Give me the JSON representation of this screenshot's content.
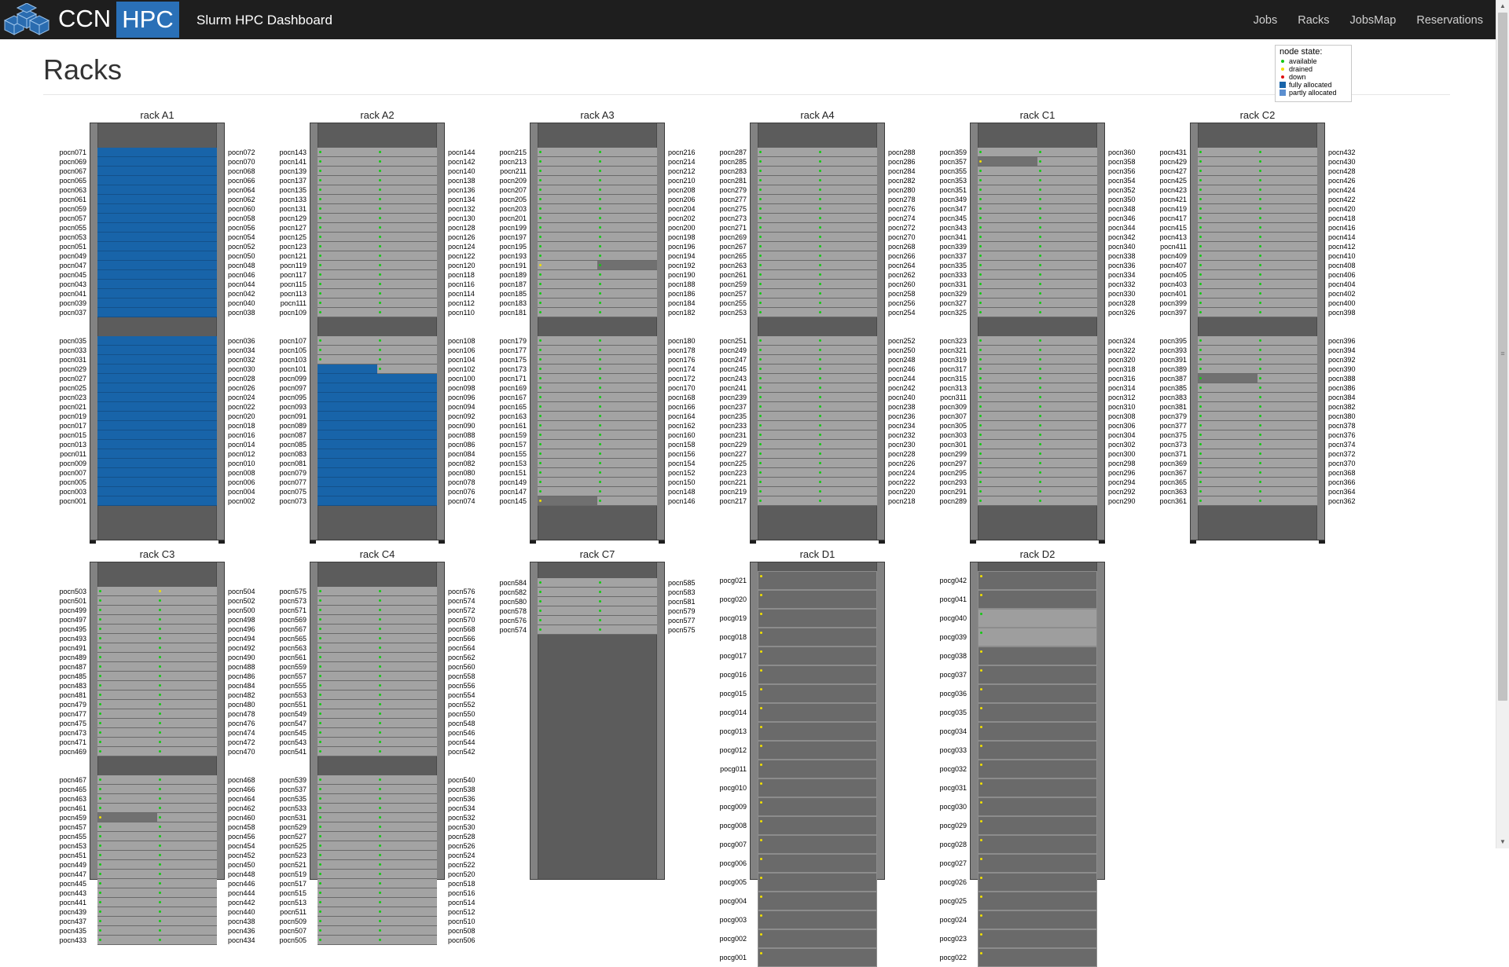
{
  "nav": {
    "brand_ccn": "CCN",
    "brand_hpc": "HPC",
    "title": "Slurm HPC Dashboard",
    "links": [
      "Jobs",
      "Racks",
      "JobsMap",
      "Reservations"
    ]
  },
  "page": {
    "title": "Racks"
  },
  "legend": {
    "title": "node state:",
    "items": [
      {
        "label": "available",
        "color": "#14c814"
      },
      {
        "label": "drained",
        "color": "#f0e000"
      },
      {
        "label": "down",
        "color": "#e01010"
      },
      {
        "label": "fully allocated",
        "color": "#1864a9"
      },
      {
        "label": "partly allocated",
        "color": "#5b8fd0"
      }
    ]
  },
  "colors": {
    "fully_allocated": "#1864a9",
    "available": "#14c814",
    "drained": "#f0e000",
    "navbar": "#1e1e1e",
    "hpc_badge": "#2a70b7"
  },
  "racks": [
    {
      "name": "rack A1",
      "start": 1,
      "full": [
        1,
        2,
        3,
        4,
        5,
        6,
        7,
        8,
        9,
        10,
        11,
        12,
        13,
        14,
        15,
        16,
        17,
        18,
        19,
        20,
        21,
        22,
        23,
        24,
        25,
        26,
        27,
        28,
        29,
        30,
        31,
        32,
        33,
        34,
        35,
        36,
        37,
        38,
        39,
        40,
        41,
        42,
        43,
        44,
        45,
        46,
        47,
        48,
        49,
        50,
        51,
        52,
        53,
        54,
        55,
        56,
        57,
        58,
        59,
        60,
        61,
        62,
        63,
        64,
        65,
        66,
        67,
        68,
        69,
        70,
        71,
        72
      ],
      "drained": [],
      "drained_bg": []
    },
    {
      "name": "rack A2",
      "start": 73,
      "full": [
        73,
        74,
        75,
        76,
        77,
        78,
        79,
        80,
        81,
        82,
        83,
        84,
        85,
        86,
        87,
        88,
        89,
        90,
        91,
        92,
        93,
        94,
        95,
        96,
        97,
        98,
        99,
        100,
        101
      ],
      "drained": [],
      "drained_bg": []
    },
    {
      "name": "rack A3",
      "start": 145,
      "full": [],
      "drained": [
        145,
        191
      ],
      "drained_bg": [
        145,
        192
      ]
    },
    {
      "name": "rack A4",
      "start": 217,
      "full": [],
      "drained": [],
      "drained_bg": []
    },
    {
      "name": "rack C1",
      "start": 289,
      "full": [],
      "drained": [
        357
      ],
      "drained_bg": [
        357
      ]
    },
    {
      "name": "rack C2",
      "start": 361,
      "full": [],
      "drained": [],
      "drained_bg": [
        387
      ]
    },
    {
      "name": "rack C3",
      "start": 433,
      "full": [],
      "drained": [
        459,
        504
      ],
      "drained_bg": [
        459
      ]
    },
    {
      "name": "rack C4",
      "start": 505,
      "full": [],
      "drained": [],
      "drained_bg": []
    },
    {
      "name": "rack C7",
      "start": 574,
      "count": 12,
      "full": [],
      "drained": [],
      "drained_bg": []
    },
    {
      "name": "rack D1",
      "prefix": "pocg",
      "start": 1,
      "count": 21,
      "drained": [],
      "light": []
    },
    {
      "name": "rack D2",
      "prefix": "pocg",
      "start": 22,
      "count": 21,
      "drained": [],
      "light": [
        39,
        40
      ]
    }
  ]
}
